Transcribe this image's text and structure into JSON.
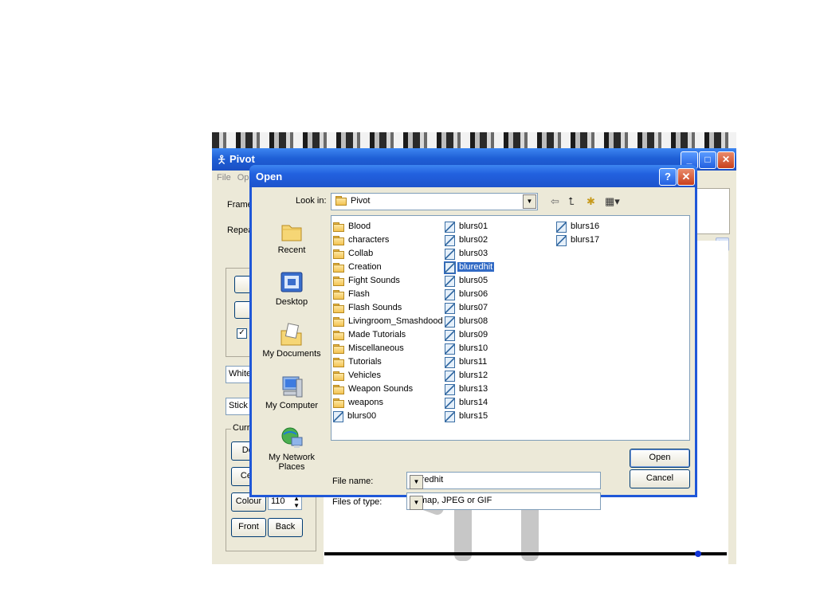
{
  "pivot": {
    "title": "Pivot",
    "menu": [
      "File",
      "Op"
    ],
    "frame_label": "Frame",
    "repeat_label": "Repea",
    "white_combo": "White",
    "sticks_combo": "Stick",
    "current_group_label": "Curre",
    "delete_button": "Del",
    "centre_button": "Cen",
    "colour_button": "Colour",
    "colour_value": "110",
    "front_button": "Front",
    "back_button": "Back",
    "checkbox_mark": "✓"
  },
  "dialog": {
    "title": "Open",
    "help_glyph": "?",
    "close_glyph": "✕",
    "look_in_label": "Look in:",
    "look_in_value": "Pivot",
    "places": [
      {
        "label": "Recent"
      },
      {
        "label": "Desktop"
      },
      {
        "label": "My Documents"
      },
      {
        "label": "My Computer"
      },
      {
        "label": "My Network Places"
      }
    ],
    "column1": [
      {
        "name": "Blood",
        "type": "folder"
      },
      {
        "name": "characters",
        "type": "folder"
      },
      {
        "name": "Collab",
        "type": "folder"
      },
      {
        "name": "Creation",
        "type": "folder"
      },
      {
        "name": "Fight Sounds",
        "type": "folder"
      },
      {
        "name": "Flash",
        "type": "folder"
      },
      {
        "name": "Flash Sounds",
        "type": "folder"
      },
      {
        "name": "Livingroom_Smashdood",
        "type": "folder"
      },
      {
        "name": "Made Tutorials",
        "type": "folder"
      },
      {
        "name": "Miscellaneous",
        "type": "folder"
      },
      {
        "name": "Tutorials",
        "type": "folder"
      },
      {
        "name": "Vehicles",
        "type": "folder"
      },
      {
        "name": "Weapon Sounds",
        "type": "folder"
      },
      {
        "name": "weapons",
        "type": "folder"
      },
      {
        "name": "blurs00",
        "type": "image"
      }
    ],
    "column2": [
      {
        "name": "blurs01",
        "type": "image"
      },
      {
        "name": "blurs02",
        "type": "image"
      },
      {
        "name": "blurs03",
        "type": "image"
      },
      {
        "name": "bluredhit",
        "type": "image"
      },
      {
        "name": "blurs05",
        "type": "image"
      },
      {
        "name": "blurs06",
        "type": "image"
      },
      {
        "name": "blurs07",
        "type": "image"
      },
      {
        "name": "blurs08",
        "type": "image"
      },
      {
        "name": "blurs09",
        "type": "image"
      },
      {
        "name": "blurs10",
        "type": "image"
      },
      {
        "name": "blurs11",
        "type": "image"
      },
      {
        "name": "blurs12",
        "type": "image"
      },
      {
        "name": "blurs13",
        "type": "image"
      },
      {
        "name": "blurs14",
        "type": "image"
      },
      {
        "name": "blurs15",
        "type": "image"
      }
    ],
    "column3": [
      {
        "name": "blurs16",
        "type": "image"
      },
      {
        "name": "blurs17",
        "type": "image"
      }
    ],
    "selected_file": "bluredhit",
    "file_name_label": "File name:",
    "file_name_value": "bluredhit",
    "file_type_label": "Files of type:",
    "file_type_value": "Bitmap, JPEG or GIF",
    "open_button": "Open",
    "cancel_button": "Cancel"
  }
}
